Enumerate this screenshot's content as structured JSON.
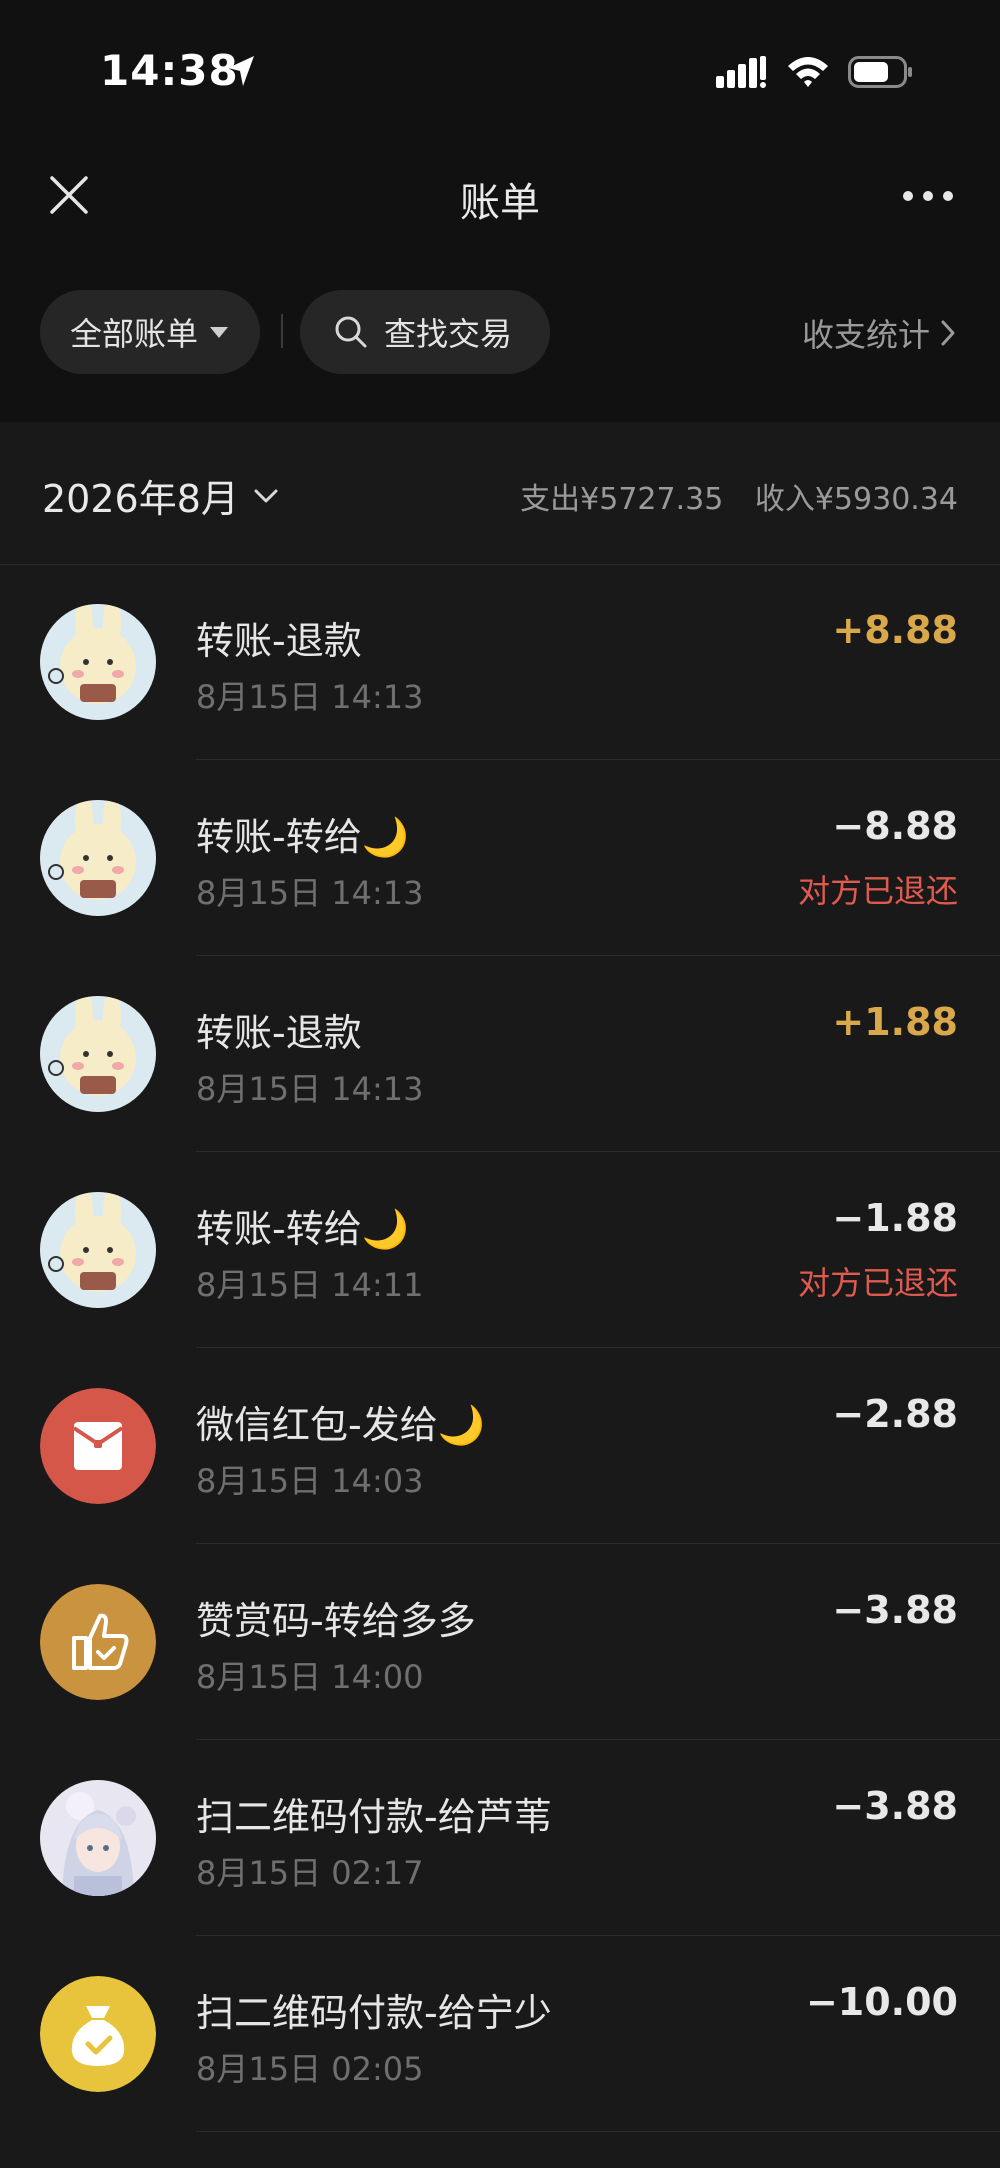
{
  "status_bar": {
    "time": "14:38"
  },
  "nav": {
    "title": "账单"
  },
  "filters": {
    "all_bills": "全部账单",
    "search": "查找交易",
    "stats": "收支统计"
  },
  "month": {
    "label": "2026年8月",
    "expense": "支出¥5727.35",
    "income": "收入¥5930.34"
  },
  "transactions": [
    {
      "title": "转账-退款",
      "date": "8月15日 14:13",
      "amount": "+8.88",
      "status": "",
      "avatar": "bunny"
    },
    {
      "title": "转账-转给🌙",
      "date": "8月15日 14:13",
      "amount": "−8.88",
      "status": "对方已退还",
      "avatar": "bunny"
    },
    {
      "title": "转账-退款",
      "date": "8月15日 14:13",
      "amount": "+1.88",
      "status": "",
      "avatar": "bunny"
    },
    {
      "title": "转账-转给🌙",
      "date": "8月15日 14:11",
      "amount": "−1.88",
      "status": "对方已退还",
      "avatar": "bunny"
    },
    {
      "title": "微信红包-发给🌙",
      "date": "8月15日 14:03",
      "amount": "−2.88",
      "status": "",
      "avatar": "red-packet-icon"
    },
    {
      "title": "赞赏码-转给多多",
      "date": "8月15日 14:00",
      "amount": "−3.88",
      "status": "",
      "avatar": "thumbs-up-icon"
    },
    {
      "title": "扫二维码付款-给芦苇",
      "date": "8月15日 02:17",
      "amount": "−3.88",
      "status": "",
      "avatar": "anime-girl"
    },
    {
      "title": "扫二维码付款-给宁少",
      "date": "8月15日 02:05",
      "amount": "−10.00",
      "status": "",
      "avatar": "money-bag-icon"
    }
  ],
  "colors": {
    "background": "#191919",
    "header": "#111111",
    "income": "#d8a84a",
    "refunded": "#e05a4f",
    "red_packet": "#d4574a",
    "reward": "#c9933f",
    "pay": "#e8c33c"
  }
}
